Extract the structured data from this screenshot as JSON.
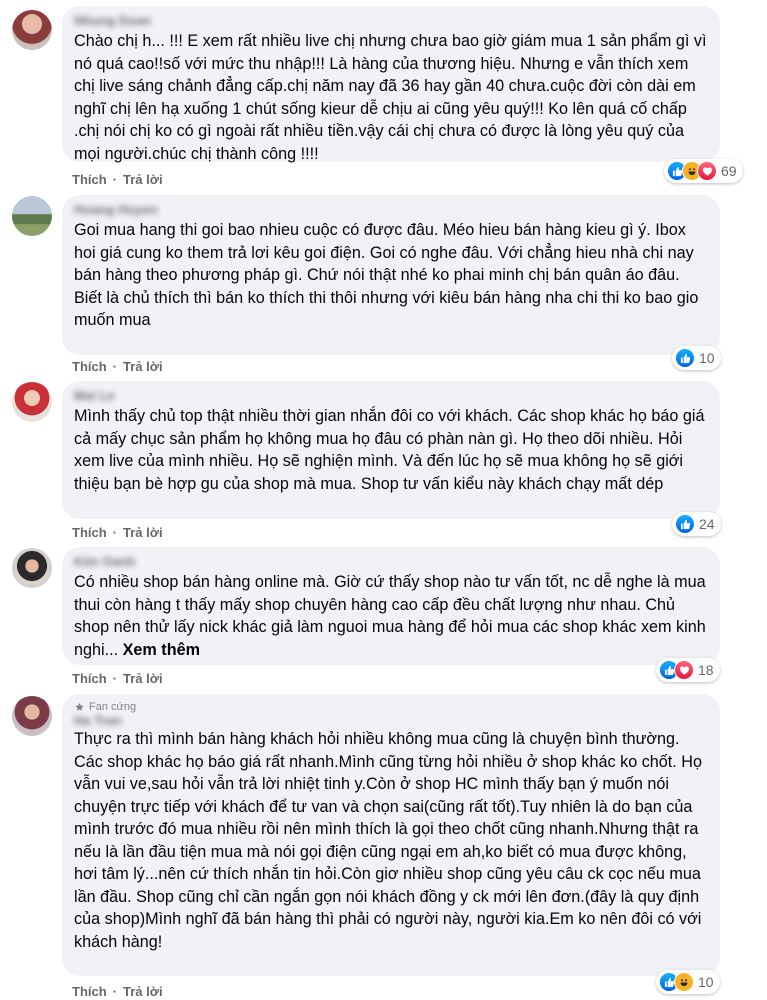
{
  "colors": {
    "bubble": "#f0f2f5",
    "action": "#65676b",
    "like": "#1877f2",
    "haha": "#f7b125",
    "love": "#f33e58"
  },
  "comments": [
    {
      "author": "Nhung Doan",
      "text": "Chào chị h... !!! E xem rất nhiều live chị nhưng chưa bao giờ giám mua 1 sản phẩm gì vì nó quá cao!!số với mức thu nhập!!! Là hàng của thương hiệu. Nhưng e vẫn thích xem chị live sáng chảnh đẳng cấp.chị năm nay đã 36 hay gần 40 chưa.cuộc đời còn dài em nghĩ chị lên hạ xuống 1 chút sống kieur dễ chịu ai cũng yêu quý!!! Ko lên quá cố chấp .chị nói chị ko có gì ngoài rất nhiều tiền.vậy cái chị chưa có được là lòng yêu quý của mọi người.chúc chị thành công !!!!",
      "like": "Thích",
      "reply": "Trả lời",
      "reactions": [
        "like-icon",
        "haha-icon",
        "love-icon"
      ],
      "count": "69"
    },
    {
      "author": "Hoang Huyen",
      "text": "Goi mua hang thi goi bao nhieu cuộc có được đâu. Méo hieu bán hàng kieu gì ý. Ibox hoi giá cung ko them trả lơi kêu goi điện. Goi có nghe đâu. Với chẳng hieu nhà chi nay bán hàng theo phương pháp gì. Chứ nói thật nhé ko phai minh chị bán quân áo đâu.\nBiết là chủ thích thì bán ko thích thi thôi nhưng với kiêu bán hàng nha chi thi ko bao gio muốn mua",
      "like": "Thích",
      "reply": "Trả lời",
      "reactions": [
        "like-icon"
      ],
      "count": "10"
    },
    {
      "author": "Mai Le",
      "text": "Mình thấy chủ top thật nhiều thời gian nhắn đôi co với khách. Các shop khác họ báo giá cả mấy chục sản phẩm họ không mua họ đâu có phàn nàn gì. Họ theo dõi nhiều. Hỏi xem live của mình nhiều. Họ sẽ nghiện mình. Và đến lúc họ sẽ mua không họ sẽ giới thiệu bạn bè hợp gu của shop mà mua. Shop tư vấn kiểu này khách chạy mất dép",
      "like": "Thích",
      "reply": "Trả lời",
      "reactions": [
        "like-icon"
      ],
      "count": "24"
    },
    {
      "author": "Kim Oanh",
      "text": "Có nhiều shop bán hàng online mà. Giờ cứ thấy shop nào tư vấn tốt, nc dễ nghe là mua thui còn hàng t thấy mấy shop chuyên hàng cao cấp đều chất lượng như nhau. Chủ shop nên thử lấy nick khác giả làm nguoi mua hàng để hỏi mua các shop khác xem kinh nghi...",
      "see_more": "Xem thêm",
      "like": "Thích",
      "reply": "Trả lời",
      "reactions": [
        "like-icon",
        "love-icon"
      ],
      "count": "18"
    },
    {
      "badge": "Fan cứng",
      "author": "Ha Tran",
      "text": "Thực ra thì mình bán hàng khách hỏi nhiều không mua cũng là chuyện bình thường. Các shop khác họ báo giá rất nhanh.Mình cũng từng hỏi nhiều ở shop khác ko chốt. Họ vẫn vui ve,sau hỏi vẫn trả lời nhiệt tinh y.Còn ở shop HC mình thấy bạn ý muốn nói chuyện trực tiếp với khách để tư van và chọn sai(cũng rất tốt).Tuy nhiên là do bạn của mình trước đó mua nhiều rồi nên mình thích là gọi theo chốt cũng nhanh.Nhưng thật ra nếu là lần đầu tiện mua mà nói gọi điện cũng ngại em ah,ko biết có mua được không, hơi tâm lý...nên cứ thích nhắn tin hỏi.Còn giơ nhiều shop cũng yêu câu ck cọc nếu mua lần đầu. Shop cũng chỉ cần ngắn gọn nói khách đồng y ck mới lên đơn.(đây là quy định của shop)Mình nghĩ đã bán hàng thì phải có người này, người kia.Em ko nên đôi có với khách hàng!",
      "like": "Thích",
      "reply": "Trả lời",
      "reactions": [
        "like-icon",
        "haha-icon"
      ],
      "count": "10"
    }
  ]
}
